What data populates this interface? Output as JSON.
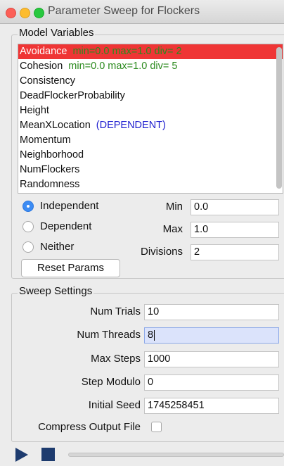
{
  "window": {
    "title": "Parameter Sweep for Flockers"
  },
  "model_variables": {
    "title": "Model Variables",
    "items": [
      {
        "name": "Avoidance",
        "detail": "min=0.0 max=1.0 div= 2"
      },
      {
        "name": "Cohesion",
        "detail": "min=0.0 max=1.0 div= 5"
      },
      {
        "name": "Consistency",
        "detail": ""
      },
      {
        "name": "DeadFlockerProbability",
        "detail": ""
      },
      {
        "name": "Height",
        "detail": ""
      },
      {
        "name": "MeanXLocation",
        "detail": "(DEPENDENT)"
      },
      {
        "name": "Momentum",
        "detail": ""
      },
      {
        "name": "Neighborhood",
        "detail": ""
      },
      {
        "name": "NumFlockers",
        "detail": ""
      },
      {
        "name": "Randomness",
        "detail": ""
      }
    ],
    "selected": "Avoidance"
  },
  "param_type": {
    "independent": "Independent",
    "dependent": "Dependent",
    "neither": "Neither",
    "selected": "Independent"
  },
  "params": {
    "min_label": "Min",
    "min_value": "0.0",
    "max_label": "Max",
    "max_value": "1.0",
    "divisions_label": "Divisions",
    "divisions_value": "2",
    "reset_label": "Reset Params"
  },
  "sweep": {
    "title": "Sweep Settings",
    "num_trials_label": "Num Trials",
    "num_trials": "10",
    "num_threads_label": "Num Threads",
    "num_threads": "8",
    "max_steps_label": "Max Steps",
    "max_steps": "1000",
    "step_modulo_label": "Step Modulo",
    "step_modulo": "0",
    "initial_seed_label": "Initial Seed",
    "initial_seed": "1745258451",
    "compress_label": "Compress Output File",
    "compress": false
  },
  "controls": {
    "play_icon": "play-icon",
    "stop_icon": "stop-icon"
  },
  "colors": {
    "selection": "#ef3535",
    "detail_green": "#2b8a1e",
    "detail_blue": "#2020d0",
    "radio_on": "#3c8cf4",
    "control_blue": "#1d3b6e"
  }
}
